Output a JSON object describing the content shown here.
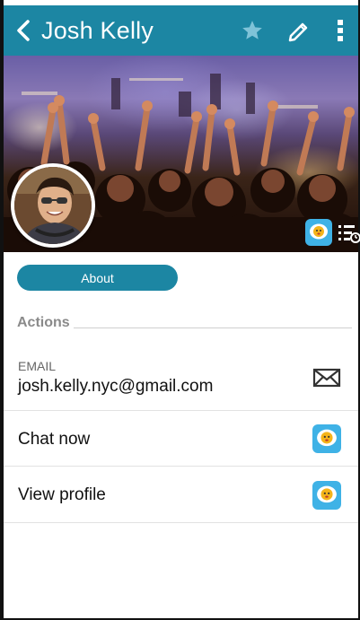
{
  "header": {
    "title": "Josh Kelly",
    "back_icon": "chevron-left-icon",
    "favorite_icon": "star-icon",
    "edit_icon": "pencil-icon",
    "more_icon": "more-vert-icon",
    "bar_color": "#1c86a3"
  },
  "profile": {
    "avatar_icon": "avatar",
    "chat_badge_icon": "chat-face-icon",
    "timeline_icon": "timeline-icon"
  },
  "about_button": {
    "label": "About"
  },
  "actions": {
    "section_label": "Actions",
    "email": {
      "label": "EMAIL",
      "value": "josh.kelly.nyc@gmail.com",
      "icon": "mail-icon"
    },
    "chat": {
      "label": "Chat now",
      "icon": "chat-face-icon"
    },
    "profile": {
      "label": "View profile",
      "icon": "chat-face-icon"
    }
  },
  "colors": {
    "accent": "#1c86a3",
    "chat_icon": "#3fb2e6"
  }
}
